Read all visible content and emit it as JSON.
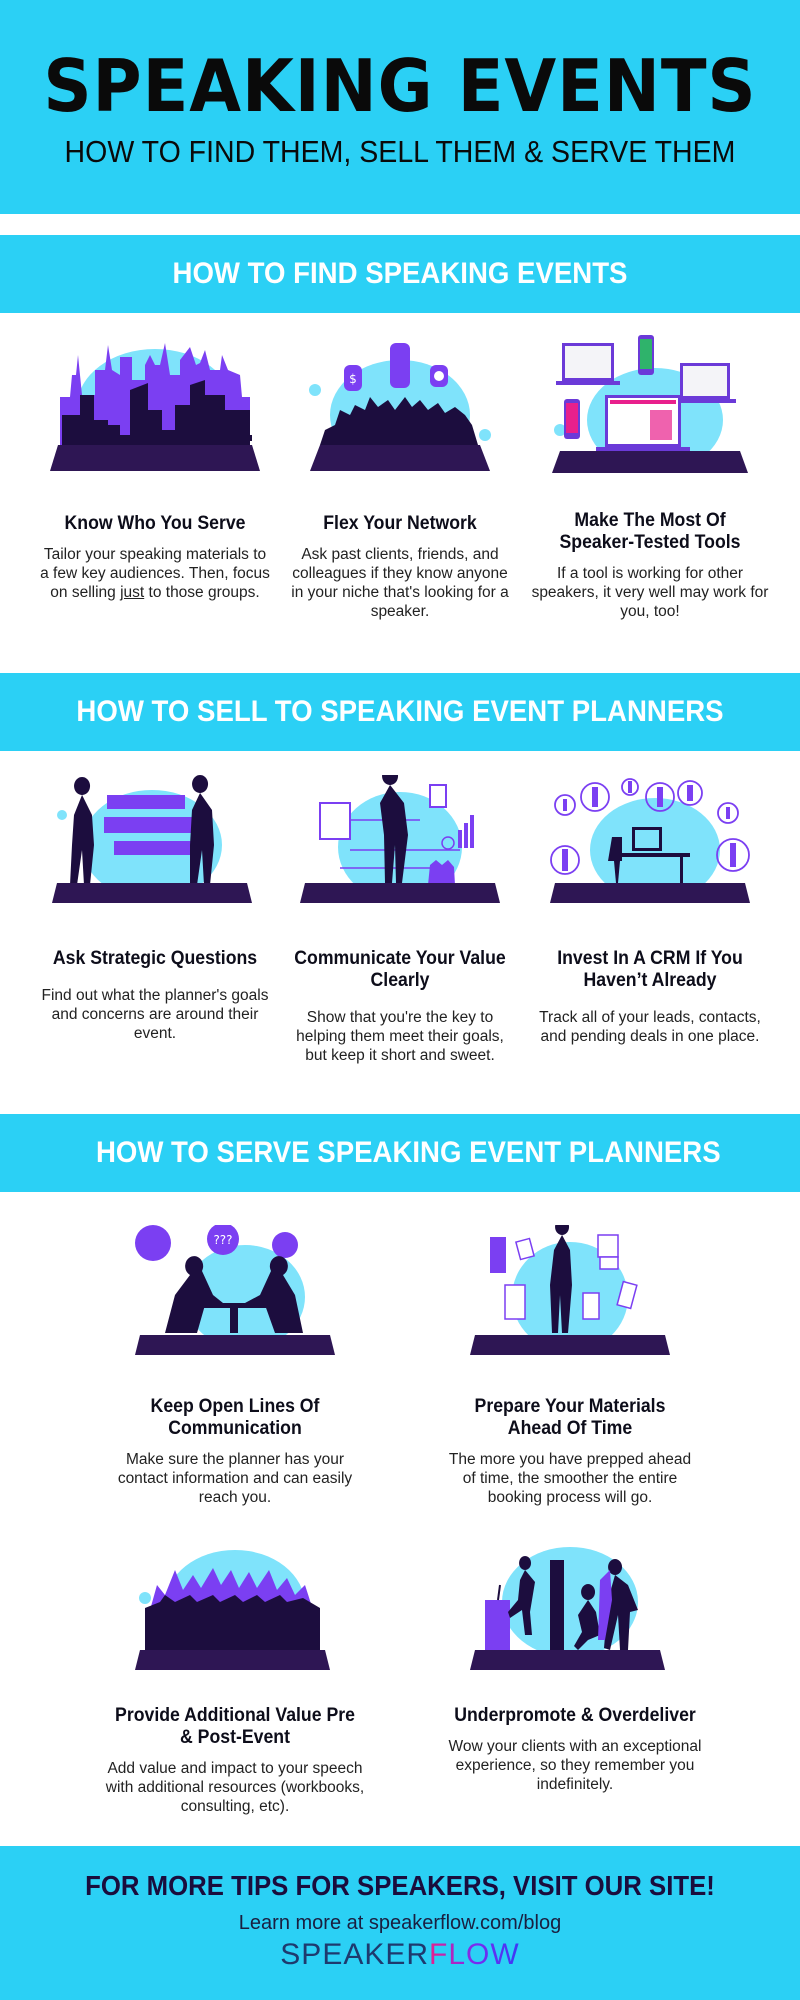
{
  "hero": {
    "title": "SPEAKING EVENTS",
    "subtitle": "HOW TO FIND THEM, SELL THEM & SERVE THEM"
  },
  "colors": {
    "brand_cyan": "#2bd0f5",
    "deep_purple": "#2e1654",
    "violet": "#7b3ff2",
    "light_blue": "#7fe3fb"
  },
  "sections": [
    {
      "heading": "HOW TO FIND SPEAKING EVENTS",
      "cards": [
        {
          "icon": "city-skyline-icon",
          "title": "Know Who You Serve",
          "desc_pre": "Tailor your speaking materials to a few key audiences. Then, focus on selling ",
          "desc_em": "just",
          "desc_post": " to those groups."
        },
        {
          "icon": "network-meeting-icon",
          "title": "Flex Your Network",
          "desc": "Ask past clients, friends, and colleagues if they know anyone in your niche that's looking for a speaker."
        },
        {
          "icon": "devices-tools-icon",
          "title": "Make The Most Of Speaker-Tested Tools",
          "desc": "If a tool is working for other speakers, it very well may work for you, too!"
        }
      ]
    },
    {
      "heading": "HOW TO SELL TO SPEAKING EVENT PLANNERS",
      "cards": [
        {
          "icon": "conversation-icon",
          "title": "Ask Strategic Questions",
          "desc": "Find out what the planner's goals and concerns are around their event."
        },
        {
          "icon": "presenter-value-icon",
          "title": "Communicate Your Value Clearly",
          "desc": "Show that you're the key to helping them meet their goals, but keep it short and sweet."
        },
        {
          "icon": "crm-desk-icon",
          "title": "Invest In A CRM If You Haven’t Already",
          "desc": "Track all of your leads, contacts, and pending deals in one place."
        }
      ]
    },
    {
      "heading": "HOW TO SERVE SPEAKING EVENT PLANNERS",
      "cards": [
        {
          "icon": "table-discussion-icon",
          "title": "Keep Open Lines Of Communication",
          "desc": "Make sure the planner has your contact information and can easily reach you."
        },
        {
          "icon": "materials-documents-icon",
          "title": "Prepare Your Materials Ahead Of Time",
          "desc": "The more you have prepped ahead of time, the smoother the entire booking process will go."
        },
        {
          "icon": "audience-crowd-icon",
          "title": "Provide Additional Value Pre & Post-Event",
          "desc": "Add value and impact to your speech with additional resources (workbooks, consulting, etc)."
        },
        {
          "icon": "celebration-stage-icon",
          "title": "Underpromote & Overdeliver",
          "desc": "Wow your clients with an exceptional experience, so they remember you indefinitely."
        }
      ]
    }
  ],
  "footer": {
    "cta": "FOR MORE TIPS FOR SPEAKERS, VISIT OUR SITE!",
    "learn_more": "Learn more at speakerflow.com/blog",
    "logo_part1": "SPEAKER",
    "logo_part2": "FLOW"
  }
}
